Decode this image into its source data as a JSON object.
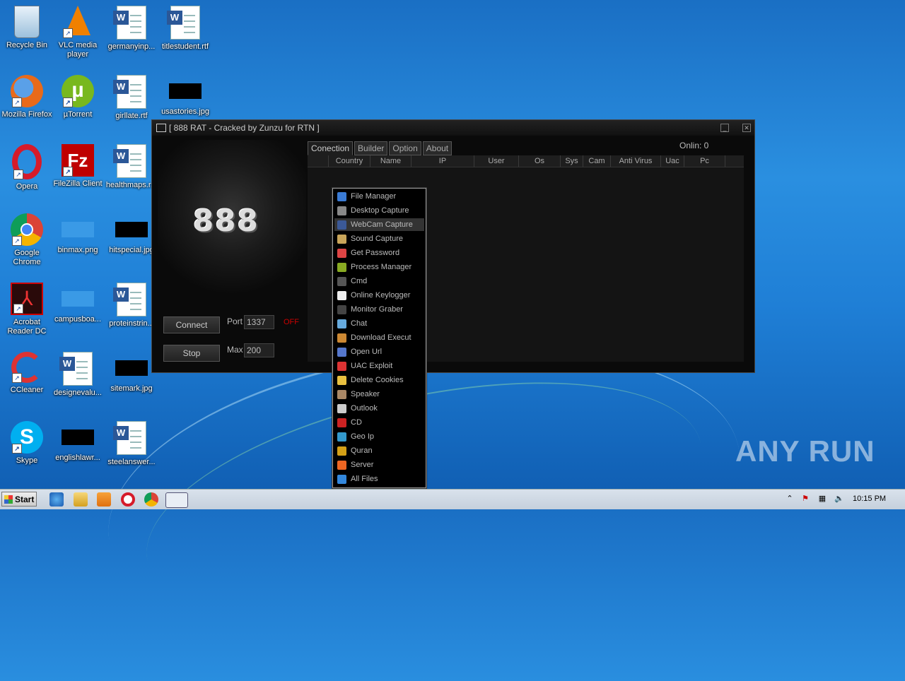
{
  "desktop": {
    "icons": [
      {
        "label": "Recycle Bin"
      },
      {
        "label": "VLC media player"
      },
      {
        "label": "germanyinp..."
      },
      {
        "label": "titlestudent.rtf"
      },
      {
        "label": "Mozilla Firefox"
      },
      {
        "label": "µTorrent"
      },
      {
        "label": "girllate.rtf"
      },
      {
        "label": "usastories.jpg"
      },
      {
        "label": "Opera"
      },
      {
        "label": "FileZilla Client"
      },
      {
        "label": "healthmaps.r..."
      },
      {
        "label": "Google Chrome"
      },
      {
        "label": "binmax.png"
      },
      {
        "label": "hitspecial.jpg"
      },
      {
        "label": "Acrobat Reader DC"
      },
      {
        "label": "campusboa..."
      },
      {
        "label": "proteinstrin..."
      },
      {
        "label": "CCleaner"
      },
      {
        "label": "designevalu..."
      },
      {
        "label": "sitemark.jpg"
      },
      {
        "label": "Skype"
      },
      {
        "label": "englishlawr..."
      },
      {
        "label": "steelanswer..."
      }
    ]
  },
  "window": {
    "title": "[ 888 RAT - Cracked by Zunzu for RTN ]",
    "logo": "888",
    "connect_label": "Connect",
    "stop_label": "Stop",
    "port_label": "Port",
    "port_value": "1337",
    "max_label": "Max",
    "max_value": "200",
    "status": "OFF",
    "online_text": "Onlin:  0",
    "tabs": [
      "Conection",
      "Builder",
      "Option",
      "About"
    ],
    "columns": [
      "",
      "Country",
      "Name",
      "IP",
      "User",
      "Os",
      "Sys",
      "Cam",
      "Anti Virus",
      "Uac",
      "Pc"
    ]
  },
  "context_menu": {
    "items": [
      {
        "label": "File Manager",
        "icon": "folder-app-icon",
        "color": "#3a7bd5"
      },
      {
        "label": "Desktop Capture",
        "icon": "monitor-icon",
        "color": "#888888"
      },
      {
        "label": "WebCam Capture",
        "icon": "facebook-icon",
        "color": "#3b5998"
      },
      {
        "label": "Sound Capture",
        "icon": "audio-icon",
        "color": "#c9a55a"
      },
      {
        "label": "Get Password",
        "icon": "cloud-key-icon",
        "color": "#dd4444"
      },
      {
        "label": "Process Manager",
        "icon": "process-icon",
        "color": "#88aa22"
      },
      {
        "label": "Cmd",
        "icon": "terminal-icon",
        "color": "#555555"
      },
      {
        "label": "Online Keylogger",
        "icon": "keylogger-icon",
        "color": "#eeeeee"
      },
      {
        "label": "Monitor Graber",
        "icon": "monitor-grab-icon",
        "color": "#444444"
      },
      {
        "label": "Chat",
        "icon": "chat-bubble-icon",
        "color": "#66aadd"
      },
      {
        "label": "Download Execut",
        "icon": "cookie-icon",
        "color": "#cc8833"
      },
      {
        "label": "Open Url",
        "icon": "speaker-url-icon",
        "color": "#5577cc"
      },
      {
        "label": "UAC Exploit",
        "icon": "shield-down-icon",
        "color": "#dd3333"
      },
      {
        "label": "Delete Cookies",
        "icon": "folder-icon",
        "color": "#e8c040"
      },
      {
        "label": "Speaker",
        "icon": "speaker-icon",
        "color": "#aa8866"
      },
      {
        "label": "Outlook",
        "icon": "disc-icon",
        "color": "#cccccc"
      },
      {
        "label": "CD",
        "icon": "lips-icon",
        "color": "#cc2222"
      },
      {
        "label": "Geo Ip",
        "icon": "globe-icon",
        "color": "#3399cc"
      },
      {
        "label": "Quran",
        "icon": "lock-icon",
        "color": "#d4a017"
      },
      {
        "label": "Server",
        "icon": "sun-icon",
        "color": "#ee6622"
      },
      {
        "label": "All Files",
        "icon": "help-icon",
        "color": "#3388dd"
      }
    ],
    "selected_index": 2
  },
  "taskbar": {
    "start_label": "Start",
    "clock": "10:15 PM"
  },
  "watermark": "ANY RUN"
}
